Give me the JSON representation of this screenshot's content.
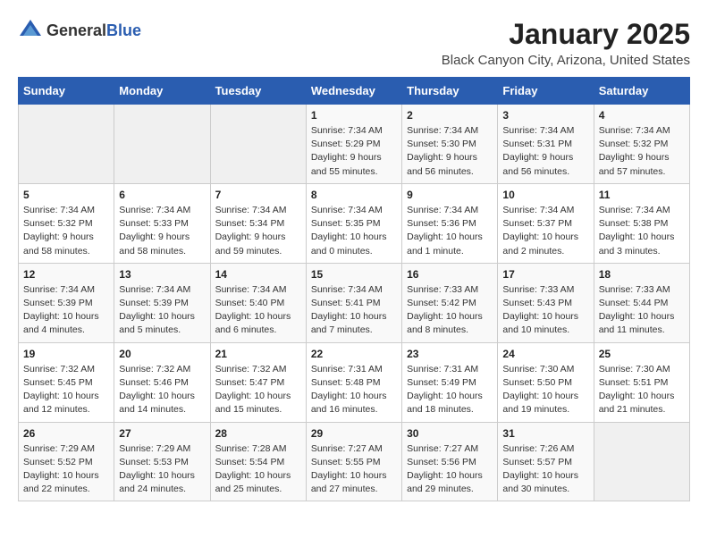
{
  "logo": {
    "text_general": "General",
    "text_blue": "Blue"
  },
  "header": {
    "month_title": "January 2025",
    "location": "Black Canyon City, Arizona, United States"
  },
  "weekdays": [
    "Sunday",
    "Monday",
    "Tuesday",
    "Wednesday",
    "Thursday",
    "Friday",
    "Saturday"
  ],
  "weeks": [
    [
      {
        "day": "",
        "sunrise": "",
        "sunset": "",
        "daylight": ""
      },
      {
        "day": "",
        "sunrise": "",
        "sunset": "",
        "daylight": ""
      },
      {
        "day": "",
        "sunrise": "",
        "sunset": "",
        "daylight": ""
      },
      {
        "day": "1",
        "sunrise": "Sunrise: 7:34 AM",
        "sunset": "Sunset: 5:29 PM",
        "daylight": "Daylight: 9 hours and 55 minutes."
      },
      {
        "day": "2",
        "sunrise": "Sunrise: 7:34 AM",
        "sunset": "Sunset: 5:30 PM",
        "daylight": "Daylight: 9 hours and 56 minutes."
      },
      {
        "day": "3",
        "sunrise": "Sunrise: 7:34 AM",
        "sunset": "Sunset: 5:31 PM",
        "daylight": "Daylight: 9 hours and 56 minutes."
      },
      {
        "day": "4",
        "sunrise": "Sunrise: 7:34 AM",
        "sunset": "Sunset: 5:32 PM",
        "daylight": "Daylight: 9 hours and 57 minutes."
      }
    ],
    [
      {
        "day": "5",
        "sunrise": "Sunrise: 7:34 AM",
        "sunset": "Sunset: 5:32 PM",
        "daylight": "Daylight: 9 hours and 58 minutes."
      },
      {
        "day": "6",
        "sunrise": "Sunrise: 7:34 AM",
        "sunset": "Sunset: 5:33 PM",
        "daylight": "Daylight: 9 hours and 58 minutes."
      },
      {
        "day": "7",
        "sunrise": "Sunrise: 7:34 AM",
        "sunset": "Sunset: 5:34 PM",
        "daylight": "Daylight: 9 hours and 59 minutes."
      },
      {
        "day": "8",
        "sunrise": "Sunrise: 7:34 AM",
        "sunset": "Sunset: 5:35 PM",
        "daylight": "Daylight: 10 hours and 0 minutes."
      },
      {
        "day": "9",
        "sunrise": "Sunrise: 7:34 AM",
        "sunset": "Sunset: 5:36 PM",
        "daylight": "Daylight: 10 hours and 1 minute."
      },
      {
        "day": "10",
        "sunrise": "Sunrise: 7:34 AM",
        "sunset": "Sunset: 5:37 PM",
        "daylight": "Daylight: 10 hours and 2 minutes."
      },
      {
        "day": "11",
        "sunrise": "Sunrise: 7:34 AM",
        "sunset": "Sunset: 5:38 PM",
        "daylight": "Daylight: 10 hours and 3 minutes."
      }
    ],
    [
      {
        "day": "12",
        "sunrise": "Sunrise: 7:34 AM",
        "sunset": "Sunset: 5:39 PM",
        "daylight": "Daylight: 10 hours and 4 minutes."
      },
      {
        "day": "13",
        "sunrise": "Sunrise: 7:34 AM",
        "sunset": "Sunset: 5:39 PM",
        "daylight": "Daylight: 10 hours and 5 minutes."
      },
      {
        "day": "14",
        "sunrise": "Sunrise: 7:34 AM",
        "sunset": "Sunset: 5:40 PM",
        "daylight": "Daylight: 10 hours and 6 minutes."
      },
      {
        "day": "15",
        "sunrise": "Sunrise: 7:34 AM",
        "sunset": "Sunset: 5:41 PM",
        "daylight": "Daylight: 10 hours and 7 minutes."
      },
      {
        "day": "16",
        "sunrise": "Sunrise: 7:33 AM",
        "sunset": "Sunset: 5:42 PM",
        "daylight": "Daylight: 10 hours and 8 minutes."
      },
      {
        "day": "17",
        "sunrise": "Sunrise: 7:33 AM",
        "sunset": "Sunset: 5:43 PM",
        "daylight": "Daylight: 10 hours and 10 minutes."
      },
      {
        "day": "18",
        "sunrise": "Sunrise: 7:33 AM",
        "sunset": "Sunset: 5:44 PM",
        "daylight": "Daylight: 10 hours and 11 minutes."
      }
    ],
    [
      {
        "day": "19",
        "sunrise": "Sunrise: 7:32 AM",
        "sunset": "Sunset: 5:45 PM",
        "daylight": "Daylight: 10 hours and 12 minutes."
      },
      {
        "day": "20",
        "sunrise": "Sunrise: 7:32 AM",
        "sunset": "Sunset: 5:46 PM",
        "daylight": "Daylight: 10 hours and 14 minutes."
      },
      {
        "day": "21",
        "sunrise": "Sunrise: 7:32 AM",
        "sunset": "Sunset: 5:47 PM",
        "daylight": "Daylight: 10 hours and 15 minutes."
      },
      {
        "day": "22",
        "sunrise": "Sunrise: 7:31 AM",
        "sunset": "Sunset: 5:48 PM",
        "daylight": "Daylight: 10 hours and 16 minutes."
      },
      {
        "day": "23",
        "sunrise": "Sunrise: 7:31 AM",
        "sunset": "Sunset: 5:49 PM",
        "daylight": "Daylight: 10 hours and 18 minutes."
      },
      {
        "day": "24",
        "sunrise": "Sunrise: 7:30 AM",
        "sunset": "Sunset: 5:50 PM",
        "daylight": "Daylight: 10 hours and 19 minutes."
      },
      {
        "day": "25",
        "sunrise": "Sunrise: 7:30 AM",
        "sunset": "Sunset: 5:51 PM",
        "daylight": "Daylight: 10 hours and 21 minutes."
      }
    ],
    [
      {
        "day": "26",
        "sunrise": "Sunrise: 7:29 AM",
        "sunset": "Sunset: 5:52 PM",
        "daylight": "Daylight: 10 hours and 22 minutes."
      },
      {
        "day": "27",
        "sunrise": "Sunrise: 7:29 AM",
        "sunset": "Sunset: 5:53 PM",
        "daylight": "Daylight: 10 hours and 24 minutes."
      },
      {
        "day": "28",
        "sunrise": "Sunrise: 7:28 AM",
        "sunset": "Sunset: 5:54 PM",
        "daylight": "Daylight: 10 hours and 25 minutes."
      },
      {
        "day": "29",
        "sunrise": "Sunrise: 7:27 AM",
        "sunset": "Sunset: 5:55 PM",
        "daylight": "Daylight: 10 hours and 27 minutes."
      },
      {
        "day": "30",
        "sunrise": "Sunrise: 7:27 AM",
        "sunset": "Sunset: 5:56 PM",
        "daylight": "Daylight: 10 hours and 29 minutes."
      },
      {
        "day": "31",
        "sunrise": "Sunrise: 7:26 AM",
        "sunset": "Sunset: 5:57 PM",
        "daylight": "Daylight: 10 hours and 30 minutes."
      },
      {
        "day": "",
        "sunrise": "",
        "sunset": "",
        "daylight": ""
      }
    ]
  ]
}
